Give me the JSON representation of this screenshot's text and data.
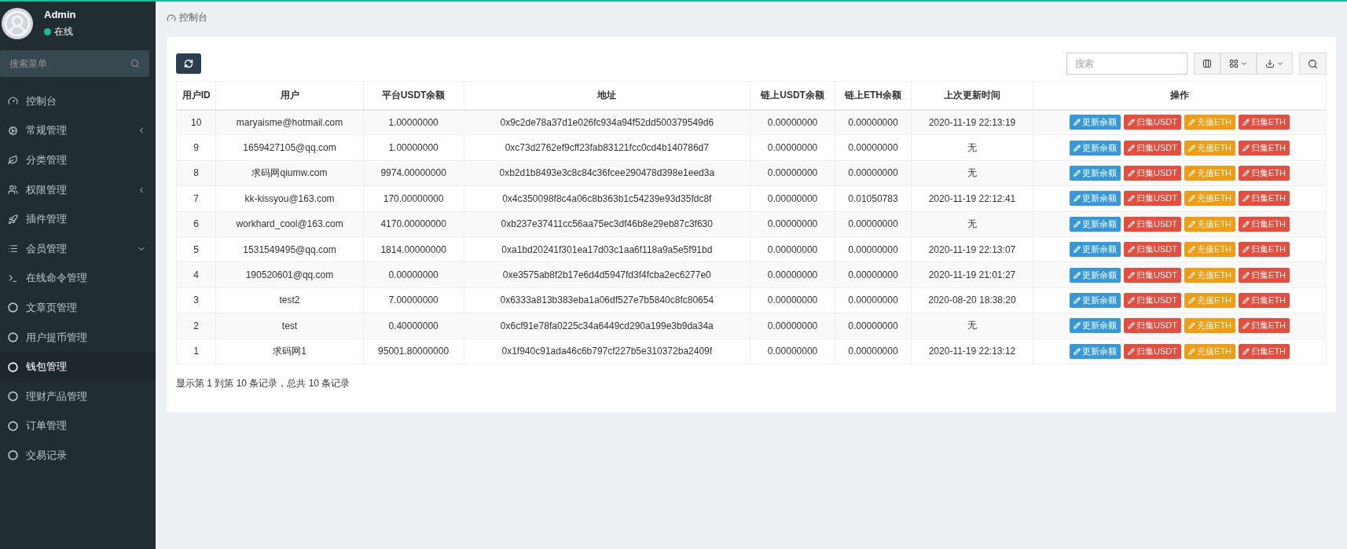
{
  "user": {
    "name": "Admin",
    "status": "在线"
  },
  "sidebar": {
    "search": {
      "placeholder": "搜索菜单"
    },
    "items": [
      {
        "label": "控制台",
        "kind": "gauge",
        "selected": false
      },
      {
        "label": "常规管理",
        "kind": "cogs",
        "expanded": false,
        "selected": false
      },
      {
        "label": "分类管理",
        "kind": "leaf",
        "selected": false
      },
      {
        "label": "权限管理",
        "kind": "users",
        "expanded": false,
        "selected": false
      },
      {
        "label": "插件管理",
        "kind": "rocket",
        "selected": false
      },
      {
        "label": "会员管理",
        "kind": "list",
        "expanded": true,
        "selected": false
      },
      {
        "label": "在线命令管理",
        "kind": "terminal",
        "selected": false
      },
      {
        "label": "文章页管理",
        "kind": "circle",
        "selected": false
      },
      {
        "label": "用户提币管理",
        "kind": "circle",
        "selected": false
      },
      {
        "label": "钱包管理",
        "kind": "circle",
        "selected": true
      },
      {
        "label": "理财产品管理",
        "kind": "circle",
        "selected": false
      },
      {
        "label": "订单管理",
        "kind": "circle",
        "selected": false
      },
      {
        "label": "交易记录",
        "kind": "circle",
        "selected": false
      }
    ]
  },
  "breadcrumb": "控制台",
  "toolbar": {
    "search": {
      "placeholder": "搜索"
    }
  },
  "table": {
    "columns": [
      "用户ID",
      "用户",
      "平台USDT余额",
      "地址",
      "链上USDT余额",
      "链上ETH余额",
      "上次更新时间",
      "操作"
    ],
    "rows": [
      {
        "cells": [
          "10",
          "maryaisme@hotmail.com",
          "1.00000000",
          "0x9c2de78a37d1e026fc934a94f52dd500379549d6",
          "0.00000000",
          "0.00000000",
          "2020-11-19 22:13:19"
        ],
        "actions": [
          {
            "label": "更新余额",
            "kind": "info"
          },
          {
            "label": "归集USDT",
            "kind": "danger"
          },
          {
            "label": "充值ETH",
            "kind": "warning"
          },
          {
            "label": "归集ETH",
            "kind": "danger"
          }
        ]
      },
      {
        "cells": [
          "9",
          "1659427105@qq.com",
          "1.00000000",
          "0xc73d2762ef9cff23fab83121fcc0cd4b140786d7",
          "0.00000000",
          "0.00000000",
          "无"
        ],
        "actions": [
          {
            "label": "更新余额",
            "kind": "info"
          },
          {
            "label": "归集USDT",
            "kind": "danger"
          },
          {
            "label": "充值ETH",
            "kind": "warning"
          },
          {
            "label": "归集ETH",
            "kind": "danger"
          }
        ]
      },
      {
        "cells": [
          "8",
          "求码网qiumw.com",
          "9974.00000000",
          "0xb2d1b8493e3c8c84c36fcee290478d398e1eed3a",
          "0.00000000",
          "0.00000000",
          "无"
        ],
        "actions": [
          {
            "label": "更新余额",
            "kind": "info"
          },
          {
            "label": "归集USDT",
            "kind": "danger"
          },
          {
            "label": "充值ETH",
            "kind": "warning"
          },
          {
            "label": "归集ETH",
            "kind": "danger"
          }
        ]
      },
      {
        "cells": [
          "7",
          "kk-kissyou@163.com",
          "170.00000000",
          "0x4c350098f8c4a06c8b363b1c54239e93d35fdc8f",
          "0.00000000",
          "0.01050783",
          "2020-11-19 22:12:41"
        ],
        "actions": [
          {
            "label": "更新余额",
            "kind": "info"
          },
          {
            "label": "归集USDT",
            "kind": "danger"
          },
          {
            "label": "充值ETH",
            "kind": "warning"
          },
          {
            "label": "归集ETH",
            "kind": "danger"
          }
        ]
      },
      {
        "cells": [
          "6",
          "workhard_cool@163.com",
          "4170.00000000",
          "0xb237e37411cc56aa75ec3df46b8e29eb87c3f630",
          "0.00000000",
          "0.00000000",
          "无"
        ],
        "actions": [
          {
            "label": "更新余额",
            "kind": "info"
          },
          {
            "label": "归集USDT",
            "kind": "danger"
          },
          {
            "label": "充值ETH",
            "kind": "warning"
          },
          {
            "label": "归集ETH",
            "kind": "danger"
          }
        ]
      },
      {
        "cells": [
          "5",
          "1531549495@qq.com",
          "1814.00000000",
          "0xa1bd20241f301ea17d03c1aa6f118a9a5e5f91bd",
          "0.00000000",
          "0.00000000",
          "2020-11-19 22:13:07"
        ],
        "actions": [
          {
            "label": "更新余额",
            "kind": "info"
          },
          {
            "label": "归集USDT",
            "kind": "danger"
          },
          {
            "label": "充值ETH",
            "kind": "warning"
          },
          {
            "label": "归集ETH",
            "kind": "danger"
          }
        ]
      },
      {
        "cells": [
          "4",
          "190520601@qq.com",
          "0.00000000",
          "0xe3575ab8f2b17e6d4d5947fd3f4fcba2ec6277e0",
          "0.00000000",
          "0.00000000",
          "2020-11-19 21:01:27"
        ],
        "actions": [
          {
            "label": "更新余额",
            "kind": "info"
          },
          {
            "label": "归集USDT",
            "kind": "danger"
          },
          {
            "label": "充值ETH",
            "kind": "warning"
          },
          {
            "label": "归集ETH",
            "kind": "danger"
          }
        ]
      },
      {
        "cells": [
          "3",
          "test2",
          "7.00000000",
          "0x6333a813b383eba1a06df527e7b5840c8fc80654",
          "0.00000000",
          "0.00000000",
          "2020-08-20 18:38:20"
        ],
        "actions": [
          {
            "label": "更新余额",
            "kind": "info"
          },
          {
            "label": "归集USDT",
            "kind": "danger"
          },
          {
            "label": "充值ETH",
            "kind": "warning"
          },
          {
            "label": "归集ETH",
            "kind": "danger"
          }
        ]
      },
      {
        "cells": [
          "2",
          "test",
          "0.40000000",
          "0x6cf91e78fa0225c34a6449cd290a199e3b9da34a",
          "0.00000000",
          "0.00000000",
          "无"
        ],
        "actions": [
          {
            "label": "更新余额",
            "kind": "info"
          },
          {
            "label": "归集USDT",
            "kind": "danger"
          },
          {
            "label": "充值ETH",
            "kind": "warning"
          },
          {
            "label": "归集ETH",
            "kind": "danger"
          }
        ]
      },
      {
        "cells": [
          "1",
          "求码网1",
          "95001.80000000",
          "0x1f940c91ada46c6b797cf227b5e310372ba2409f",
          "0.00000000",
          "0.00000000",
          "2020-11-19 22:13:12"
        ],
        "actions": [
          {
            "label": "更新余额",
            "kind": "info"
          },
          {
            "label": "归集USDT",
            "kind": "danger"
          },
          {
            "label": "充值ETH",
            "kind": "warning"
          },
          {
            "label": "归集ETH",
            "kind": "danger"
          }
        ]
      }
    ]
  },
  "pagination": "显示第 1 到第 10 条记录，总共 10 条记录"
}
